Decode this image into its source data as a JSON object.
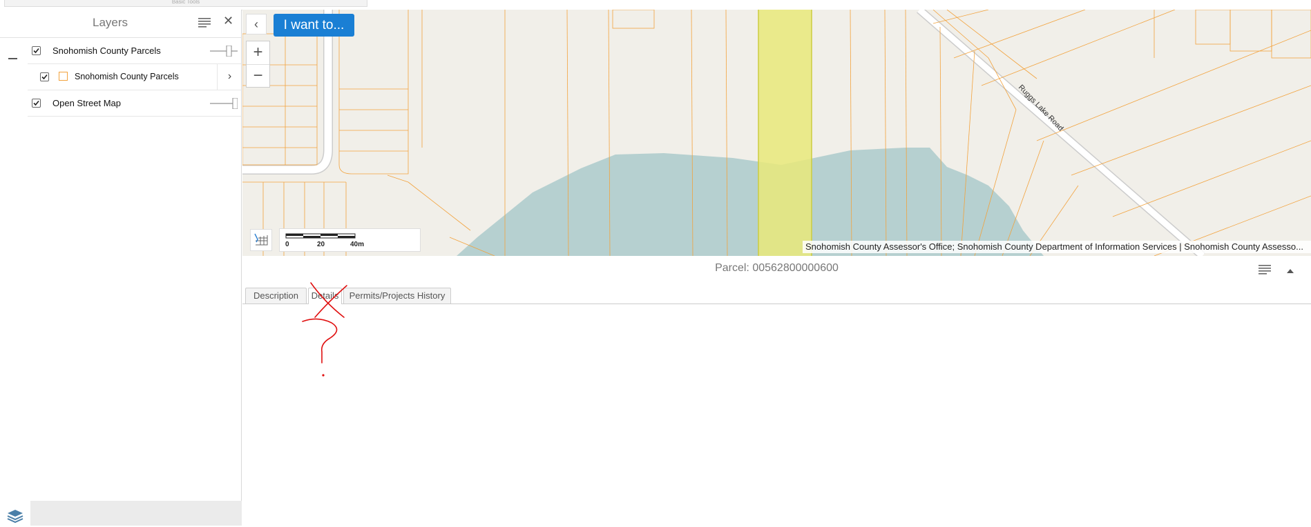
{
  "toolbar": {
    "tab_label": "Basic Tools"
  },
  "layers_panel": {
    "title": "Layers",
    "items": [
      {
        "label": "Snohomish County Parcels",
        "checked": true,
        "level": 0
      },
      {
        "label": "Snohomish County Parcels",
        "checked": true,
        "level": 1,
        "legend_color": "#f2a23c"
      },
      {
        "label": "Open Street Map",
        "checked": true,
        "level": 0
      }
    ]
  },
  "map": {
    "i_want_to_label": "I want to...",
    "road_label": "Ruggs Lake Road",
    "scale": {
      "labels": [
        "0",
        "20",
        "40m"
      ]
    },
    "attribution": "Snohomish County Assessor's Office; Snohomish County Department of Information Services | Snohomish County Assesso...",
    "colors": {
      "parcel_line": "#f2a23c",
      "highlight": "#ebeb7f",
      "water": "#b6d0d0",
      "background": "#f1efe9"
    }
  },
  "details": {
    "title": "Parcel: 00562800000600",
    "tabs": [
      {
        "label": "Description",
        "active": false
      },
      {
        "label": "Details",
        "active": true
      },
      {
        "label": "Permits/Projects History",
        "active": false
      }
    ]
  },
  "colors": {
    "accent": "#1a7fd4",
    "annotation": "#e01010"
  }
}
